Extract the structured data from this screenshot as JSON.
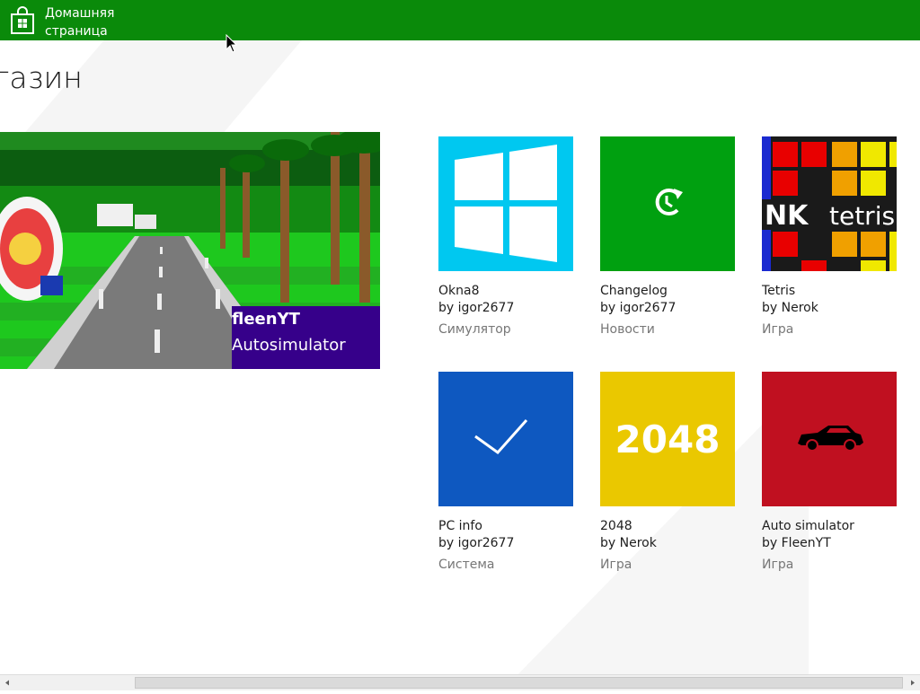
{
  "header": {
    "home_label_line1": "Домашняя",
    "home_label_line2": "страница",
    "bg_color": "#0a8a0a"
  },
  "page": {
    "title": "агазин"
  },
  "featured": {
    "author": "fleenYT",
    "name": "Autosimulator",
    "caption_color": "#36008a"
  },
  "apps": [
    {
      "name": "Okna8",
      "author": "by igor2677",
      "category": "Симулятор",
      "icon": "windows-logo-icon",
      "color": "#00c8f0"
    },
    {
      "name": "Changelog",
      "author": "by igor2677",
      "category": "Новости",
      "icon": "refresh-clock-icon",
      "color": "#00a010"
    },
    {
      "name": "Tetris",
      "author": "by Nerok",
      "category": "Игра",
      "icon": "tetris-logo-icon",
      "color": "#1a1a1a",
      "tile_label_left": "NK",
      "tile_label_right": "tetris"
    },
    {
      "name": "PC info",
      "author": "by igor2677",
      "category": "Система",
      "icon": "checkmark-icon",
      "color": "#0e58c0"
    },
    {
      "name": "2048",
      "author": "by Nerok",
      "category": "Игра",
      "icon": "2048-icon",
      "color": "#eac800",
      "tile_label": "2048"
    },
    {
      "name": "Auto simulator",
      "author": "by FleenYT",
      "category": "Игра",
      "icon": "car-icon",
      "color": "#c01020"
    }
  ]
}
